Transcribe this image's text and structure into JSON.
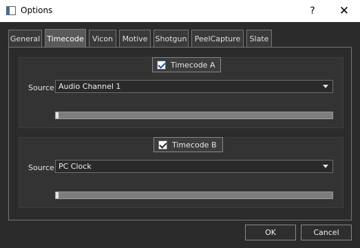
{
  "window": {
    "title": "Options",
    "help_label": "?",
    "close_label": "✕"
  },
  "tabs": [
    {
      "label": "General"
    },
    {
      "label": "Timecode"
    },
    {
      "label": "Vicon"
    },
    {
      "label": "Motive"
    },
    {
      "label": "Shotgun"
    },
    {
      "label": "PeelCapture"
    },
    {
      "label": "Slate"
    }
  ],
  "active_tab": "Timecode",
  "timecode_a": {
    "label": "Timecode A",
    "checked": true,
    "source_label": "Source",
    "source_value": "Audio Channel 1",
    "level": 0.005
  },
  "timecode_b": {
    "label": "Timecode B",
    "checked": true,
    "source_label": "Source",
    "source_value": "PC Clock",
    "level": 0.005
  },
  "buttons": {
    "ok": "OK",
    "cancel": "Cancel"
  },
  "icons": {
    "app": "window-icon",
    "combo_arrow": "chevron-down-icon"
  }
}
